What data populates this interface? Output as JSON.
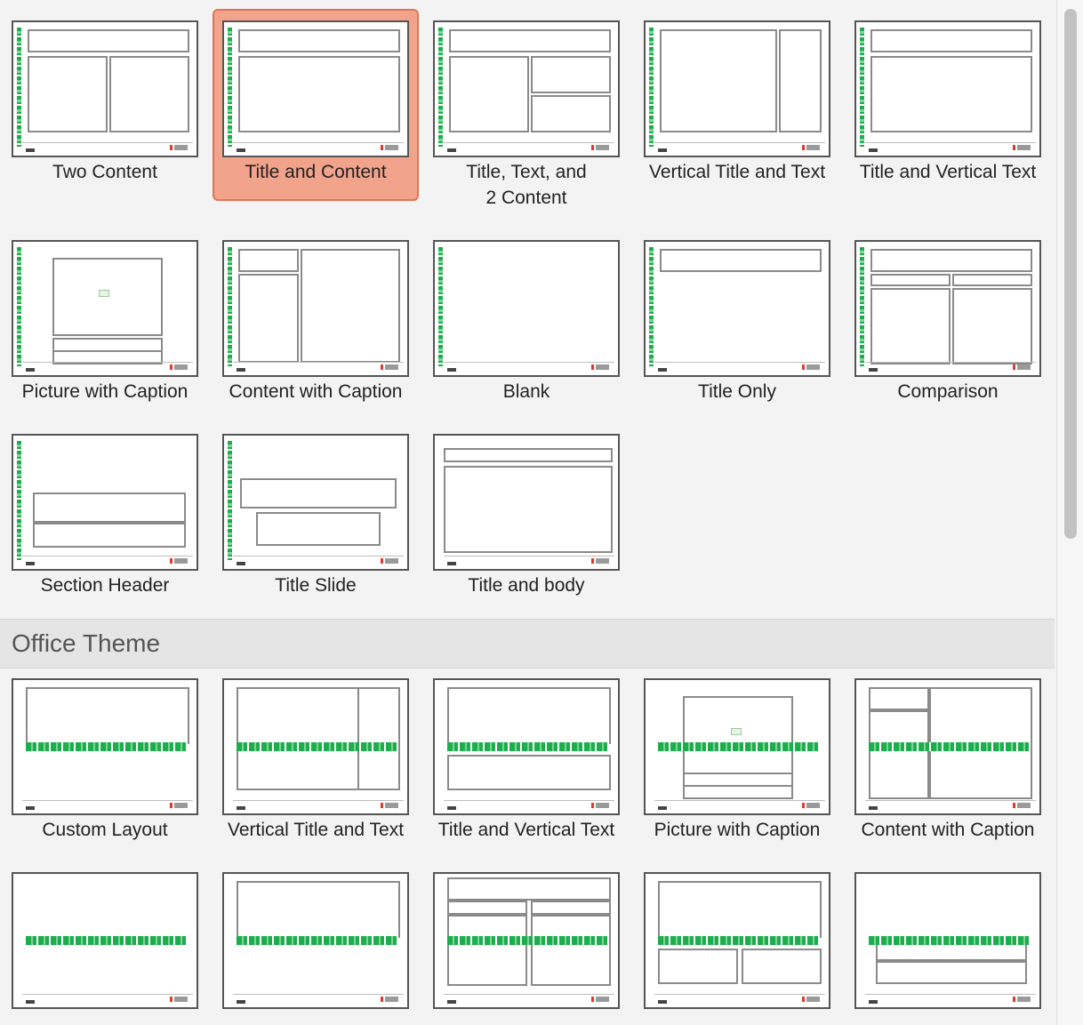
{
  "items": [
    {
      "label": "Two Content",
      "selected": false
    },
    {
      "label": "Title and Content",
      "selected": true
    },
    {
      "label": "Title, Text, and\n2 Content",
      "selected": false
    },
    {
      "label": "Vertical Title and Text",
      "selected": false
    },
    {
      "label": "Title and Vertical Text",
      "selected": false
    },
    {
      "label": "Picture with Caption",
      "selected": false
    },
    {
      "label": "Content with Caption",
      "selected": false
    },
    {
      "label": "Blank",
      "selected": false
    },
    {
      "label": "Title Only",
      "selected": false
    },
    {
      "label": "Comparison",
      "selected": false
    },
    {
      "label": "Section Header",
      "selected": false
    },
    {
      "label": "Title Slide",
      "selected": false
    },
    {
      "label": "Title and body",
      "selected": false
    }
  ],
  "section": {
    "title": "Office Theme"
  },
  "office_items": [
    {
      "label": "Custom Layout"
    },
    {
      "label": "Vertical Title and Text"
    },
    {
      "label": "Title and Vertical Text"
    },
    {
      "label": "Picture with Caption"
    },
    {
      "label": "Content with Caption"
    },
    {
      "label": ""
    },
    {
      "label": ""
    },
    {
      "label": ""
    },
    {
      "label": ""
    },
    {
      "label": ""
    }
  ],
  "colors": {
    "selection_fill": "#f2a38c",
    "selection_border": "#e27454",
    "brand_green": "#1cae4c"
  }
}
